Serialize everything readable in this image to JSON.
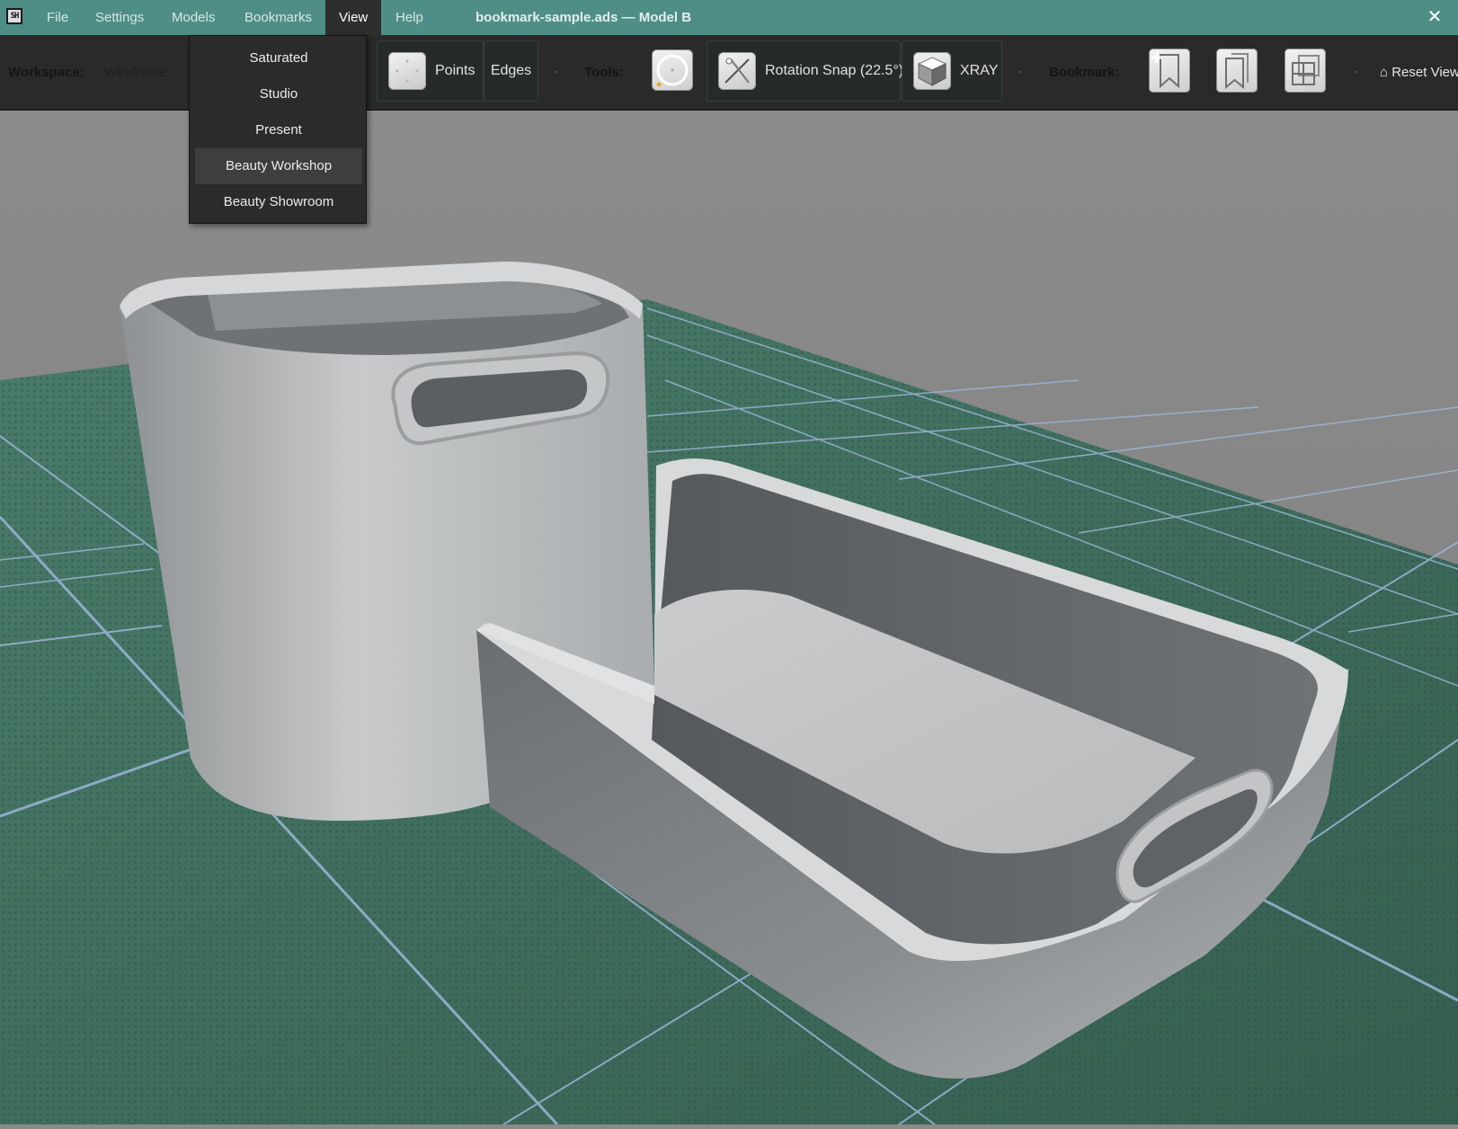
{
  "app": {
    "logo_text": "SH",
    "doc_title": "bookmark-sample.ads — Model B",
    "close_label": "✕"
  },
  "menu": [
    "File",
    "Settings",
    "Models",
    "Bookmarks",
    "View",
    "Help"
  ],
  "view_menu": {
    "items": [
      "Saturated",
      "Studio",
      "Present",
      "Beauty Workshop",
      "Beauty Showroom"
    ],
    "highlighted": "Beauty Workshop"
  },
  "toolbar": {
    "workspace_label": "Workspace:",
    "workspace_value": "Wireframe",
    "points_label": "Points",
    "edges_label": "Edges",
    "tools_label": "Tools:",
    "rotation_snap_label": "Rotation Snap (22.5°)",
    "xray_label": "XRAY",
    "bookmark_label": "Bookmark:",
    "reset_view_label": "⌂ Reset View"
  },
  "icons": {
    "points": "points-icon",
    "circle_tool": "circle-tool-icon",
    "rotation_snap": "rotation-snap-icon",
    "xray": "xray-cube-icon",
    "bookmark_add": "bookmark-add-icon",
    "bookmark_list": "bookmark-list-icon",
    "bookmark_grid": "bookmark-grid-icon"
  },
  "colors": {
    "titlebar": "#4e8e86",
    "toolbar": "#2a2a2a",
    "ground": "#3f6f5d",
    "grid_lines": "#9bb6d8",
    "model": "#b9bcbf",
    "sky": "#858585"
  }
}
